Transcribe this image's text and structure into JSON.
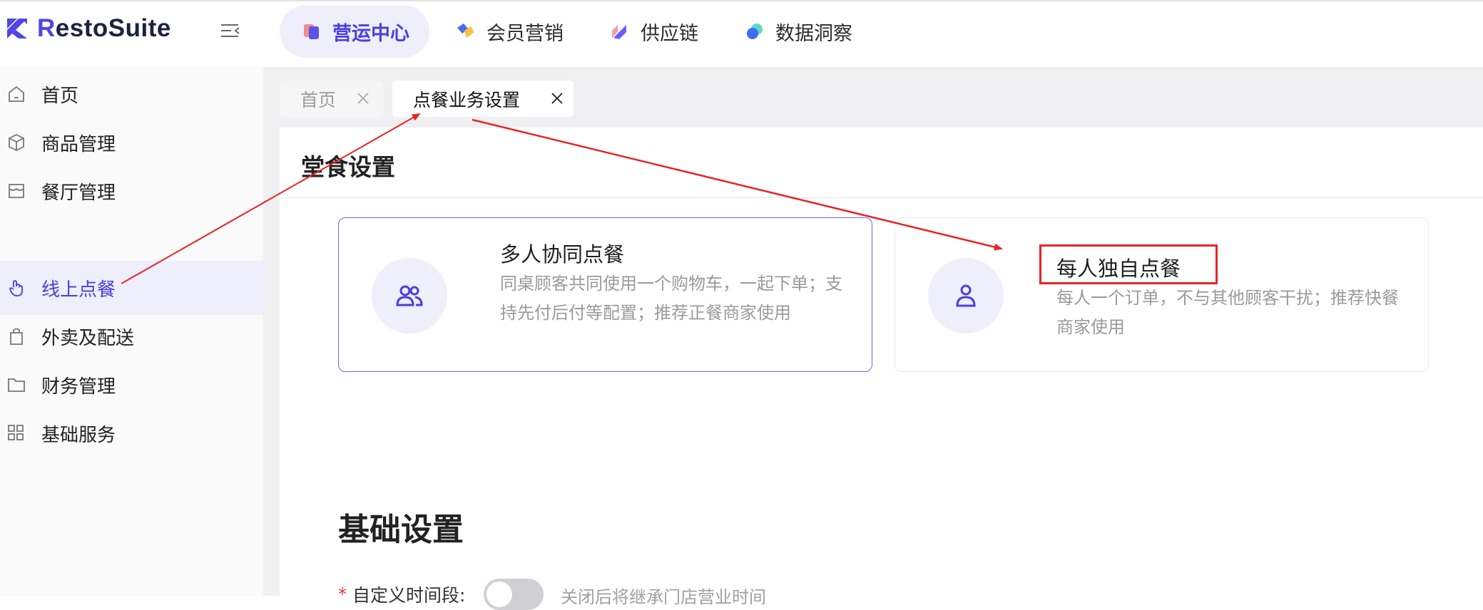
{
  "header": {
    "logo_text": "RestoSuite",
    "nav": [
      {
        "label": "营运中心",
        "icon": "operations-icon",
        "active": true
      },
      {
        "label": "会员营销",
        "icon": "member-marketing-icon",
        "active": false
      },
      {
        "label": "供应链",
        "icon": "supply-chain-icon",
        "active": false
      },
      {
        "label": "数据洞察",
        "icon": "data-insight-icon",
        "active": false
      }
    ]
  },
  "sidebar": {
    "items": [
      {
        "label": "首页",
        "icon": "home-icon"
      },
      {
        "label": "商品管理",
        "icon": "cube-icon"
      },
      {
        "label": "餐厅管理",
        "icon": "store-icon"
      },
      {
        "label": "线上点餐",
        "icon": "hand-pointer-icon",
        "active": true
      },
      {
        "label": "外卖及配送",
        "icon": "bag-icon"
      },
      {
        "label": "财务管理",
        "icon": "folder-icon"
      },
      {
        "label": "基础服务",
        "icon": "grid-icon"
      }
    ]
  },
  "tabs": [
    {
      "label": "首页",
      "active": false
    },
    {
      "label": "点餐业务设置",
      "active": true
    }
  ],
  "dine_in": {
    "title": "堂食设置",
    "cards": [
      {
        "title": "多人协同点餐",
        "description": "同桌顾客共同使用一个购物车，一起下单；支持先付后付等配置；推荐正餐商家使用",
        "selected": true,
        "icon": "group-users-icon"
      },
      {
        "title": "每人独自点餐",
        "description": "每人一个订单，不与其他顾客干扰；推荐快餐商家使用",
        "selected": false,
        "icon": "single-user-icon"
      }
    ]
  },
  "basic": {
    "title": "基础设置",
    "custom_time": {
      "label": "自定义时间段:",
      "required_mark": "*",
      "enabled": false,
      "hint": "关闭后将继承门店营业时间"
    }
  },
  "colors": {
    "accent": "#4a3fe0",
    "annotation": "#e82424"
  }
}
